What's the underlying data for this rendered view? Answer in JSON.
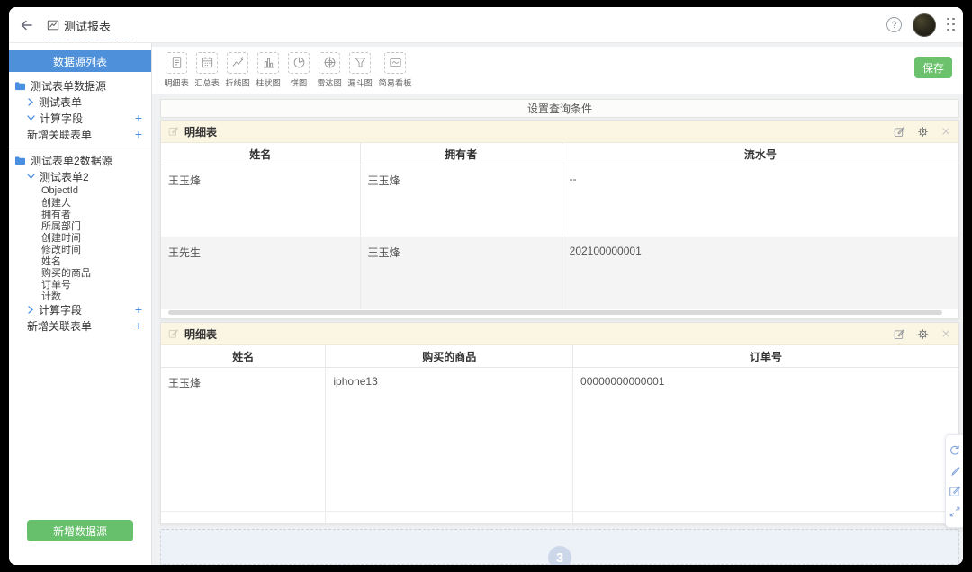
{
  "colors": {
    "accent_blue": "#4a90d9",
    "green": "#67c06b",
    "widget_header": "#fbf6e4"
  },
  "topbar": {
    "title": "测试报表",
    "help": "?"
  },
  "sidebar": {
    "header": "数据源列表",
    "folder1": "测试表单数据源",
    "folder1_form": "测试表单",
    "folder1_calc": "计算字段",
    "folder1_add_related": "新增关联表单",
    "folder2": "测试表单2数据源",
    "folder2_form": "测试表单2",
    "fields": [
      "ObjectId",
      "创建人",
      "拥有者",
      "所属部门",
      "创建时间",
      "修改时间",
      "姓名",
      "购买的商品",
      "订单号",
      "计数"
    ],
    "folder2_calc": "计算字段",
    "folder2_add_related": "新增关联表单",
    "plus": "+",
    "add_datasource_button": "新增数据源"
  },
  "toolbar": {
    "items": [
      {
        "label": "明细表"
      },
      {
        "label": "汇总表"
      },
      {
        "label": "折线图"
      },
      {
        "label": "柱状图"
      },
      {
        "label": "饼图"
      },
      {
        "label": "雷达图"
      },
      {
        "label": "漏斗图"
      },
      {
        "label": "简易看板"
      }
    ],
    "save_button": "保存"
  },
  "query_bar": {
    "label": "设置查询条件"
  },
  "widgets": [
    {
      "title": "明细表",
      "columns": [
        "姓名",
        "拥有者",
        "流水号"
      ],
      "rows": [
        [
          "王玉烽",
          "王玉烽",
          "--"
        ],
        [
          "王先生",
          "王玉烽",
          "202100000001"
        ]
      ]
    },
    {
      "title": "明细表",
      "columns": [
        "姓名",
        "购买的商品",
        "订单号"
      ],
      "rows": [
        [
          "王玉烽",
          "iphone13",
          "00000000000001"
        ]
      ]
    }
  ],
  "drop_zone": {
    "badge": "3"
  }
}
